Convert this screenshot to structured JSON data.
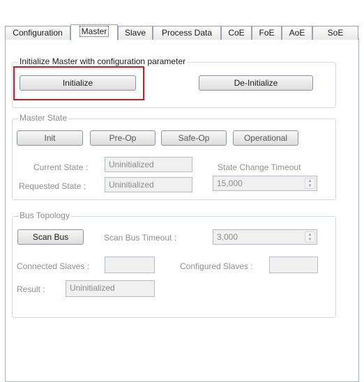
{
  "tabs": [
    {
      "label": "Configuration"
    },
    {
      "label": "Master"
    },
    {
      "label": "Slave"
    },
    {
      "label": "Process Data"
    },
    {
      "label": "CoE"
    },
    {
      "label": "FoE"
    },
    {
      "label": "AoE"
    },
    {
      "label": "SoE"
    }
  ],
  "init_group": {
    "legend": "Initialize Master with configuration parameter",
    "initialize_label": "Initialize",
    "deinitialize_label": "De-Initialize",
    "highlight_color": "#c8202a"
  },
  "master_state": {
    "legend": "Master State",
    "init_label": "Init",
    "preop_label": "Pre-Op",
    "safeop_label": "Safe-Op",
    "operational_label": "Operational",
    "current_state_label": "Current State :",
    "current_state_value": "Uninitialized",
    "requested_state_label": "Requested State :",
    "requested_state_value": "Uninitialized",
    "timeout_label": "State Change Timeout",
    "timeout_value": "15,000"
  },
  "bus_topology": {
    "legend": "Bus Topology",
    "scan_bus_label": "Scan Bus",
    "scan_timeout_label": "Scan Bus Timeout :",
    "scan_timeout_value": "3,000",
    "connected_slaves_label": "Connected Slaves :",
    "connected_slaves_value": "",
    "configured_slaves_label": "Configured Slaves :",
    "configured_slaves_value": "",
    "result_label": "Result :",
    "result_value": "Uninitialized"
  },
  "icons": {
    "spin_up": "spin-up-arrow",
    "spin_down": "spin-down-arrow"
  }
}
